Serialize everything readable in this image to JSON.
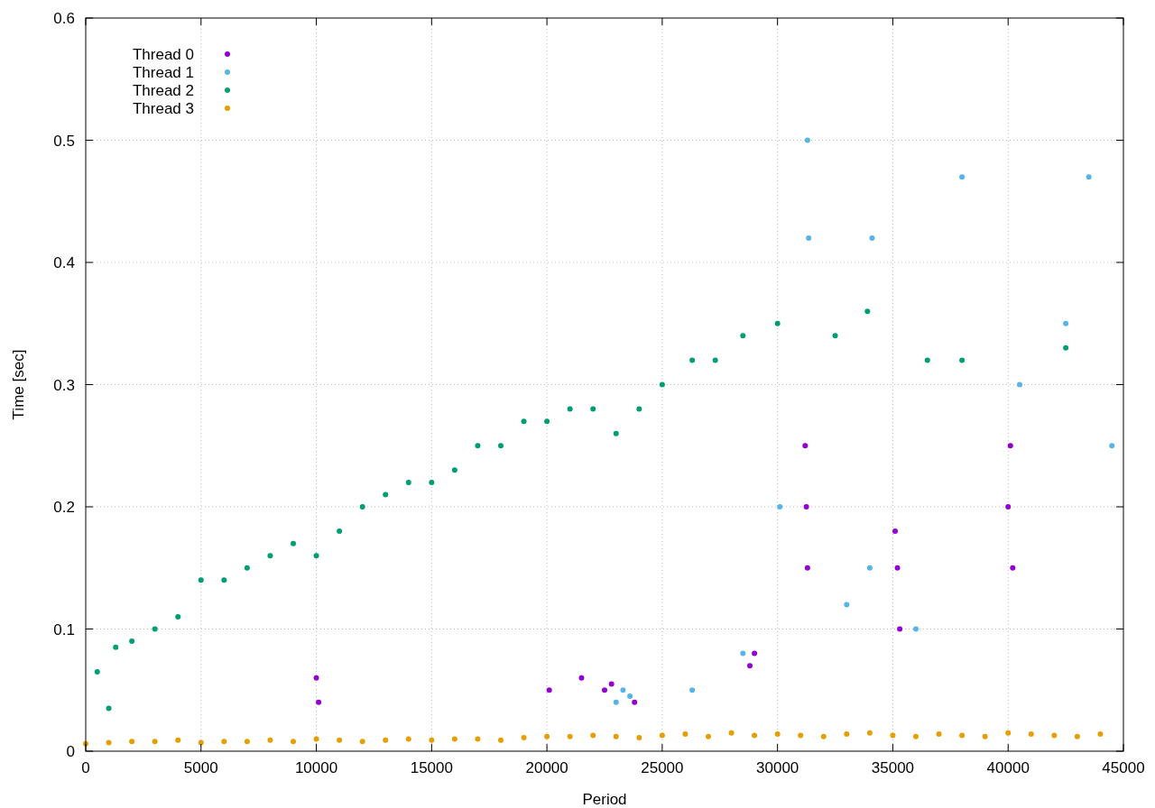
{
  "chart": {
    "chart_data": {
      "type": "scatter",
      "grid": true,
      "legend": "top left",
      "xlabel": "Period",
      "ylabel": "Time [sec]",
      "xlim": [
        0,
        45000
      ],
      "ylim": [
        0,
        0.6
      ],
      "xticks": [
        0,
        5000,
        10000,
        15000,
        20000,
        25000,
        30000,
        35000,
        40000,
        45000
      ],
      "yticks": [
        0,
        0.1,
        0.2,
        0.3,
        0.4,
        0.5,
        0.6
      ],
      "series": [
        {
          "name": "Thread 0",
          "color": "#9400d3",
          "x": [
            10000,
            10100,
            22500,
            22800,
            23800,
            28800,
            29000,
            31200,
            31250,
            31300,
            35100,
            35200,
            35300,
            40000,
            40100,
            40200,
            20100,
            21500
          ],
          "values": [
            0.06,
            0.04,
            0.05,
            0.055,
            0.04,
            0.07,
            0.08,
            0.25,
            0.2,
            0.15,
            0.18,
            0.15,
            0.1,
            0.2,
            0.25,
            0.15,
            0.05,
            0.06
          ]
        },
        {
          "name": "Thread 1",
          "color": "#56b4e9",
          "x": [
            23000,
            23300,
            23600,
            26300,
            28500,
            30100,
            31300,
            31350,
            33000,
            34000,
            34100,
            36000,
            38000,
            40500,
            42500,
            43500,
            44500
          ],
          "values": [
            0.04,
            0.05,
            0.045,
            0.05,
            0.08,
            0.2,
            0.5,
            0.42,
            0.12,
            0.15,
            0.42,
            0.1,
            0.47,
            0.3,
            0.35,
            0.47,
            0.25
          ]
        },
        {
          "name": "Thread 2",
          "color": "#009e73",
          "x": [
            500,
            1000,
            1300,
            2000,
            3000,
            4000,
            5000,
            6000,
            7000,
            8000,
            9000,
            10000,
            11000,
            12000,
            13000,
            14000,
            15000,
            16000,
            17000,
            18000,
            19000,
            20000,
            21000,
            22000,
            23000,
            24000,
            25000,
            26300,
            27300,
            28500,
            30000,
            32500,
            33900,
            36500,
            38000,
            42500
          ],
          "values": [
            0.065,
            0.035,
            0.085,
            0.09,
            0.1,
            0.11,
            0.14,
            0.14,
            0.15,
            0.16,
            0.17,
            0.16,
            0.18,
            0.2,
            0.21,
            0.22,
            0.22,
            0.23,
            0.25,
            0.25,
            0.27,
            0.27,
            0.28,
            0.28,
            0.26,
            0.28,
            0.3,
            0.32,
            0.32,
            0.34,
            0.35,
            0.34,
            0.36,
            0.32,
            0.32,
            0.33
          ]
        },
        {
          "name": "Thread 3",
          "color": "#e69f00",
          "x": [
            0,
            1000,
            2000,
            3000,
            4000,
            5000,
            6000,
            7000,
            8000,
            9000,
            10000,
            11000,
            12000,
            13000,
            14000,
            15000,
            16000,
            17000,
            18000,
            19000,
            20000,
            21000,
            22000,
            23000,
            24000,
            25000,
            26000,
            27000,
            28000,
            29000,
            30000,
            31000,
            32000,
            33000,
            34000,
            35000,
            36000,
            37000,
            38000,
            39000,
            40000,
            41000,
            42000,
            43000,
            44000
          ],
          "values": [
            0.006,
            0.007,
            0.008,
            0.008,
            0.009,
            0.007,
            0.008,
            0.008,
            0.009,
            0.008,
            0.01,
            0.009,
            0.008,
            0.009,
            0.01,
            0.009,
            0.01,
            0.01,
            0.009,
            0.011,
            0.012,
            0.012,
            0.013,
            0.012,
            0.011,
            0.013,
            0.014,
            0.012,
            0.015,
            0.013,
            0.014,
            0.013,
            0.012,
            0.014,
            0.015,
            0.013,
            0.012,
            0.014,
            0.013,
            0.012,
            0.015,
            0.014,
            0.013,
            0.012,
            0.014
          ]
        }
      ]
    }
  }
}
